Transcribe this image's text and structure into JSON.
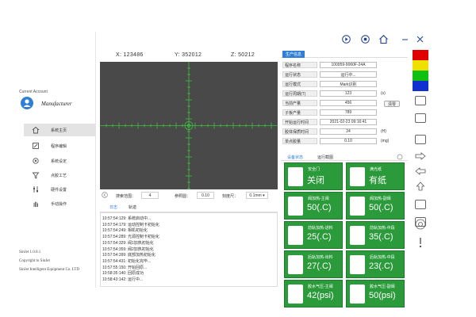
{
  "sidebar": {
    "account_label": "Current Account",
    "account_name": "Manufacturer",
    "items": [
      {
        "label": "系统主页",
        "icon": "home-icon",
        "active": true
      },
      {
        "label": "程序编辑",
        "icon": "edit-icon",
        "active": false
      },
      {
        "label": "系统设定",
        "icon": "gear-icon",
        "active": false
      },
      {
        "label": "点胶工艺",
        "icon": "funnel-icon",
        "active": false
      },
      {
        "label": "硬件设置",
        "icon": "sliders-icon",
        "active": false
      },
      {
        "label": "手动操作",
        "icon": "hand-icon",
        "active": false
      }
    ],
    "version": "SinJet 1.0.0.1",
    "copyright": "Copyright to SinJet",
    "company": "SinJet Intelligent Equipment Co. LTD"
  },
  "coords": {
    "x_label": "X:",
    "x": "123486",
    "y_label": "Y:",
    "y": "352012",
    "z_label": "Z:",
    "z": "50212"
  },
  "params": {
    "search_label": "搜索范围：",
    "search_value": "4",
    "ref_label": "参照圆：",
    "ref_value": "0.10",
    "scale_label": "刻度尺：",
    "scale_value": "0.1mm"
  },
  "log": {
    "tabs": [
      "日志",
      "轨迹"
    ],
    "lines": [
      "10:57:54:129: 系统启动中...",
      "10:57:54:179: 运动控制卡初始化",
      "10:57:54:249: 相机初始化",
      "10:57:54:289: 光源控制卡初始化",
      "10:57:54:329: 阀1加热初始化",
      "10:57:54:359: 阀2加热初始化",
      "10:57:54:399: 底部加热初始化",
      "10:57:54:431: 初始化完毕...",
      "10:57:55:150: 开始回原...",
      "10:58:35:140: 回原成功",
      "10:58:43:142: 运行中..."
    ]
  },
  "production": {
    "tab": "生产信息",
    "rows": [
      {
        "label": "程序名称",
        "value": "100959-9060F-24A",
        "unit": ""
      },
      {
        "label": "运行状态",
        "value": "运行中...",
        "unit": ""
      },
      {
        "label": "运行模式",
        "value": "Mark识别",
        "unit": ""
      },
      {
        "label": "运行周期(T)",
        "value": "123",
        "unit": "(s)"
      },
      {
        "label": "当前产量",
        "value": "456",
        "unit": ""
      },
      {
        "label": "子板产量",
        "value": "789",
        "unit": ""
      },
      {
        "label": "开始运行时间",
        "value": "2021-02-23 09:16:41",
        "unit": ""
      },
      {
        "label": "胶体保质时间",
        "value": "24",
        "unit": "(H)"
      },
      {
        "label": "单点胶量",
        "value": "0.10",
        "unit": "(mg)"
      }
    ],
    "clear_label": "清零"
  },
  "device": {
    "tabs": [
      "设备状态",
      "运行截图"
    ],
    "cards": [
      {
        "label": "安全门",
        "value": "关闭",
        "icon": "lock-icon"
      },
      {
        "label": "满光纸",
        "value": "有纸",
        "icon": "paper-icon"
      },
      {
        "label": "阀加热-主阀",
        "value": "50(.C)",
        "icon": "thermometer-icon"
      },
      {
        "label": "阀加热-副阀",
        "value": "50(.C)",
        "icon": "thermometer-icon"
      },
      {
        "label": "前轨加热-进料",
        "value": "25(.C)",
        "icon": "thermometer-icon"
      },
      {
        "label": "前轨加热-中段",
        "value": "35(.C)",
        "icon": "thermometer-icon"
      },
      {
        "label": "后轨加热-出料",
        "value": "27(.C)",
        "icon": "thermometer-icon"
      },
      {
        "label": "后轨加热-中段",
        "value": "23(.C)",
        "icon": "thermometer-icon"
      },
      {
        "label": "胶水气压-主阀",
        "value": "42(psi)",
        "icon": "gauge-icon"
      },
      {
        "label": "胶水气压-副阀",
        "value": "50(psi)",
        "icon": "gauge-icon"
      }
    ]
  },
  "colors": {
    "accent": "#2f7fd6",
    "card_green": "#2a9a3a",
    "camera_bg": "#494949",
    "crosshair": "#3fbf3f"
  },
  "status_swatches": [
    "#e00000",
    "#f0e000",
    "#10c010",
    "#1030d0"
  ]
}
